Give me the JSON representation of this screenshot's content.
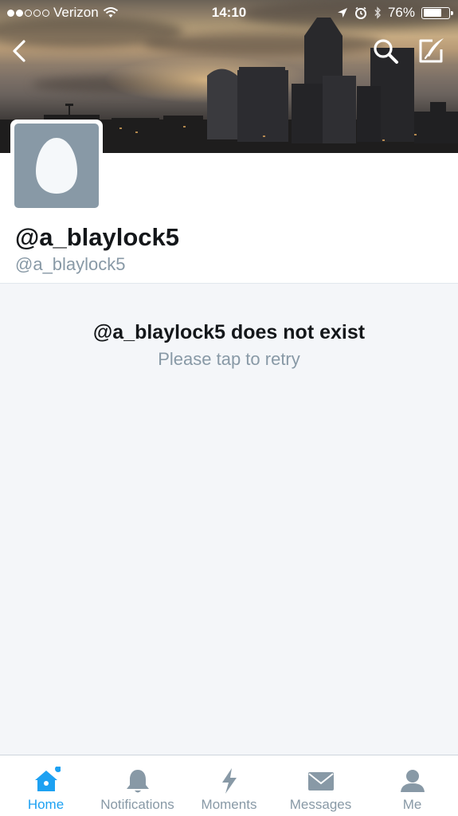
{
  "status_bar": {
    "carrier": "Verizon",
    "time": "14:10",
    "battery": "76%",
    "battery_level": 0.76,
    "signal_bars": 2
  },
  "nav": {
    "back_icon": "chevron-left-icon",
    "search_icon": "search-icon",
    "compose_icon": "compose-icon"
  },
  "profile": {
    "display_name": "@a_blaylock5",
    "screen_name": "@a_blaylock5",
    "avatar_icon": "egg-icon"
  },
  "message": {
    "title": "@a_blaylock5 does not exist",
    "retry": "Please tap to retry"
  },
  "tabs": [
    {
      "label": "Home",
      "icon": "home-icon",
      "active": true
    },
    {
      "label": "Notifications",
      "icon": "bell-icon",
      "active": false
    },
    {
      "label": "Moments",
      "icon": "lightning-icon",
      "active": false
    },
    {
      "label": "Messages",
      "icon": "envelope-icon",
      "active": false
    },
    {
      "label": "Me",
      "icon": "person-icon",
      "active": false
    }
  ],
  "colors": {
    "accent": "#1da1f2",
    "muted": "#8899a6",
    "background": "#f4f6f9"
  }
}
